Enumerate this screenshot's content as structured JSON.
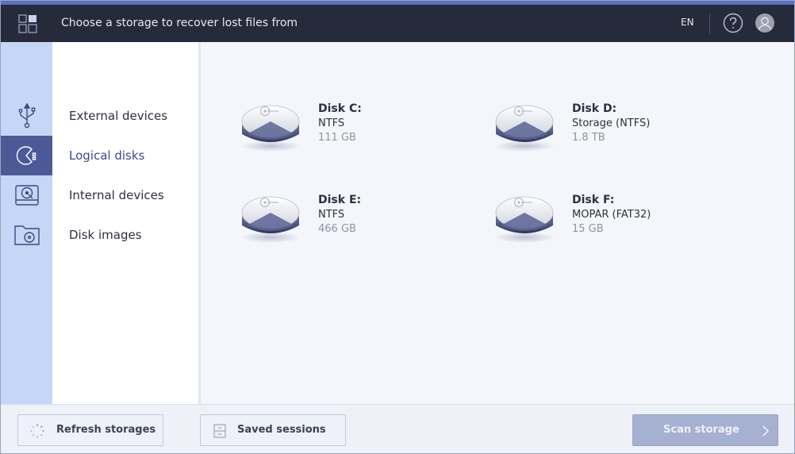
{
  "titlebar": {
    "title": "Choose a storage to recover lost files from",
    "language": "EN",
    "help_icon": "help-icon",
    "user_icon": "user-icon"
  },
  "rail": {
    "items": [
      {
        "icon": "usb-icon",
        "active": false
      },
      {
        "icon": "logical-disk-icon",
        "active": true
      },
      {
        "icon": "hard-drive-icon",
        "active": false
      },
      {
        "icon": "disk-image-icon",
        "active": false
      }
    ]
  },
  "categories": [
    {
      "label": "External devices",
      "active": false
    },
    {
      "label": "Logical disks",
      "active": true
    },
    {
      "label": "Internal devices",
      "active": false
    },
    {
      "label": "Disk images",
      "active": false
    }
  ],
  "disks": [
    {
      "name": "Disk C:",
      "fs": "NTFS",
      "size": "111 GB"
    },
    {
      "name": "Disk D:",
      "fs": "Storage (NTFS)",
      "size": "1.8 TB"
    },
    {
      "name": "Disk E:",
      "fs": "NTFS",
      "size": "466 GB"
    },
    {
      "name": "Disk F:",
      "fs": "MOPAR (FAT32)",
      "size": "15 GB"
    }
  ],
  "bottom": {
    "refresh_label": "Refresh storages",
    "sessions_label": "Saved sessions",
    "scan_label": "Scan storage"
  },
  "colors": {
    "titlebar_bg": "#262b3b",
    "accent": "#4b5a97",
    "rail_bg": "#c6d6f6",
    "scan_disabled": "#a6b1d2"
  }
}
